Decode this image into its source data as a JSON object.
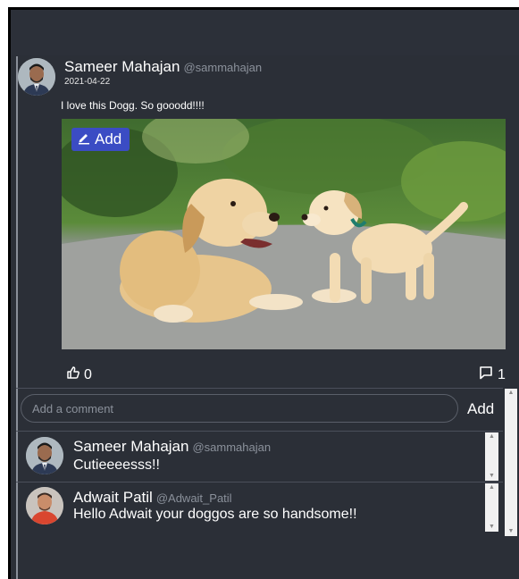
{
  "post": {
    "author_name": "Sameer Mahajan",
    "author_handle": "@sammahajan",
    "date": "2021-04-22",
    "text": "I love this Dogg. So gooodd!!!!",
    "image_button_label": "Add",
    "like_count": "0",
    "comment_count": "1"
  },
  "comment_box": {
    "placeholder": "Add a comment",
    "value": "",
    "add_label": "Add"
  },
  "comments": [
    {
      "name": "Sameer Mahajan",
      "handle": "@sammahajan",
      "text": "Cutieeeesss!!"
    },
    {
      "name": "Adwait Patil",
      "handle": "@Adwait_Patil",
      "text": "Hello Adwait your doggos are so handsome!!"
    }
  ],
  "icons": {
    "edit": "pencil-icon",
    "like": "thumbs-up-icon",
    "comment": "comment-bubble-icon"
  },
  "colors": {
    "background": "#2b2f37",
    "add_button": "#3b4cc4",
    "handle_text": "#8b919b"
  }
}
